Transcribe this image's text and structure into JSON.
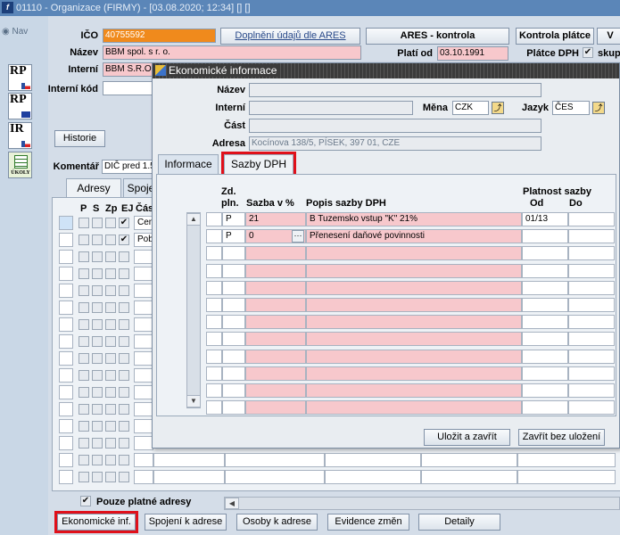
{
  "window": {
    "app_icon": "f",
    "title": "01110 - Organizace (FIRMY) - [03.08.2020; 12:34] [] []"
  },
  "nav": {
    "label": "Nav",
    "icons": [
      {
        "name": "rp-cz-icon",
        "label": "RP"
      },
      {
        "name": "rp-eu-icon",
        "label": "RP"
      },
      {
        "name": "ir-cz-icon",
        "label": "IR"
      },
      {
        "name": "ukoly-icon",
        "label": "ÚKOLY"
      }
    ]
  },
  "form": {
    "ico_label": "IČO",
    "ico_value": "40755592",
    "ares_fill_button": "Doplnění údajů dle ARES",
    "ares_check_button": "ARES - kontrola",
    "platce_check_button": "Kontrola plátce",
    "v_button": "V",
    "nazev_label": "Název",
    "nazev_value": "BBM spol. s r. o.",
    "plati_od_label": "Platí od",
    "plati_od_value": "03.10.1991",
    "platce_dph_label": "Plátce DPH",
    "skup_label": "skup",
    "interni_label": "Interní",
    "interni_value": "BBM S.R.O",
    "interni_kod_label": "Interní kód",
    "interni_kod_value": "",
    "historie_button": "Historie",
    "komentar_label": "Komentář",
    "komentar_value": "DIČ pred 1.5"
  },
  "main_tabs": [
    {
      "label": "Adresy"
    },
    {
      "label": "Spoje"
    }
  ],
  "address_grid": {
    "headers": [
      "P",
      "S",
      "Zp",
      "EJ",
      "Čás"
    ],
    "rows": [
      {
        "p": false,
        "s": false,
        "zp": false,
        "ej": true,
        "cast": "Cen"
      },
      {
        "p": false,
        "s": false,
        "zp": false,
        "ej": true,
        "cast": "Pob"
      }
    ]
  },
  "only_valid_label": "Pouze platné adresy",
  "bottom_buttons": [
    "Ekonomické inf.",
    "Spojení k adrese",
    "Osoby k adrese",
    "Evidence změn",
    "Detaily"
  ],
  "dialog": {
    "title": "Ekonomické informace",
    "nazev_label": "Název",
    "nazev_value": "",
    "interni_label": "Interní",
    "interni_value": "",
    "mena_label": "Měna",
    "mena_value": "CZK",
    "jazyk_label": "Jazyk",
    "jazyk_value": "ČES",
    "cast_label": "Část",
    "cast_value": "",
    "adresa_label": "Adresa",
    "adresa_value": "Kocínova 138/5, PÍSEK, 397 01, CZE",
    "tabs": [
      {
        "label": "Informace"
      },
      {
        "label": "Sazby DPH"
      }
    ],
    "vat_table": {
      "headers": {
        "zd": "Zd.",
        "pln": "pln.",
        "sazba": "Sazba v %",
        "popis": "Popis sazby DPH",
        "platnost": "Platnost sazby",
        "od": "Od",
        "do": "Do"
      },
      "rows": [
        {
          "zd_pln": "P",
          "sazba": "21",
          "popis": "B  Tuzemsko vstup \"K\" 21%",
          "od": "01/13",
          "do": ""
        },
        {
          "zd_pln": "P",
          "sazba": "0",
          "popis": "Přenesení daňové povinnosti",
          "od": "",
          "do": ""
        }
      ]
    },
    "save_button": "Uložit a zavřít",
    "discard_button": "Zavřít bez uložení"
  }
}
